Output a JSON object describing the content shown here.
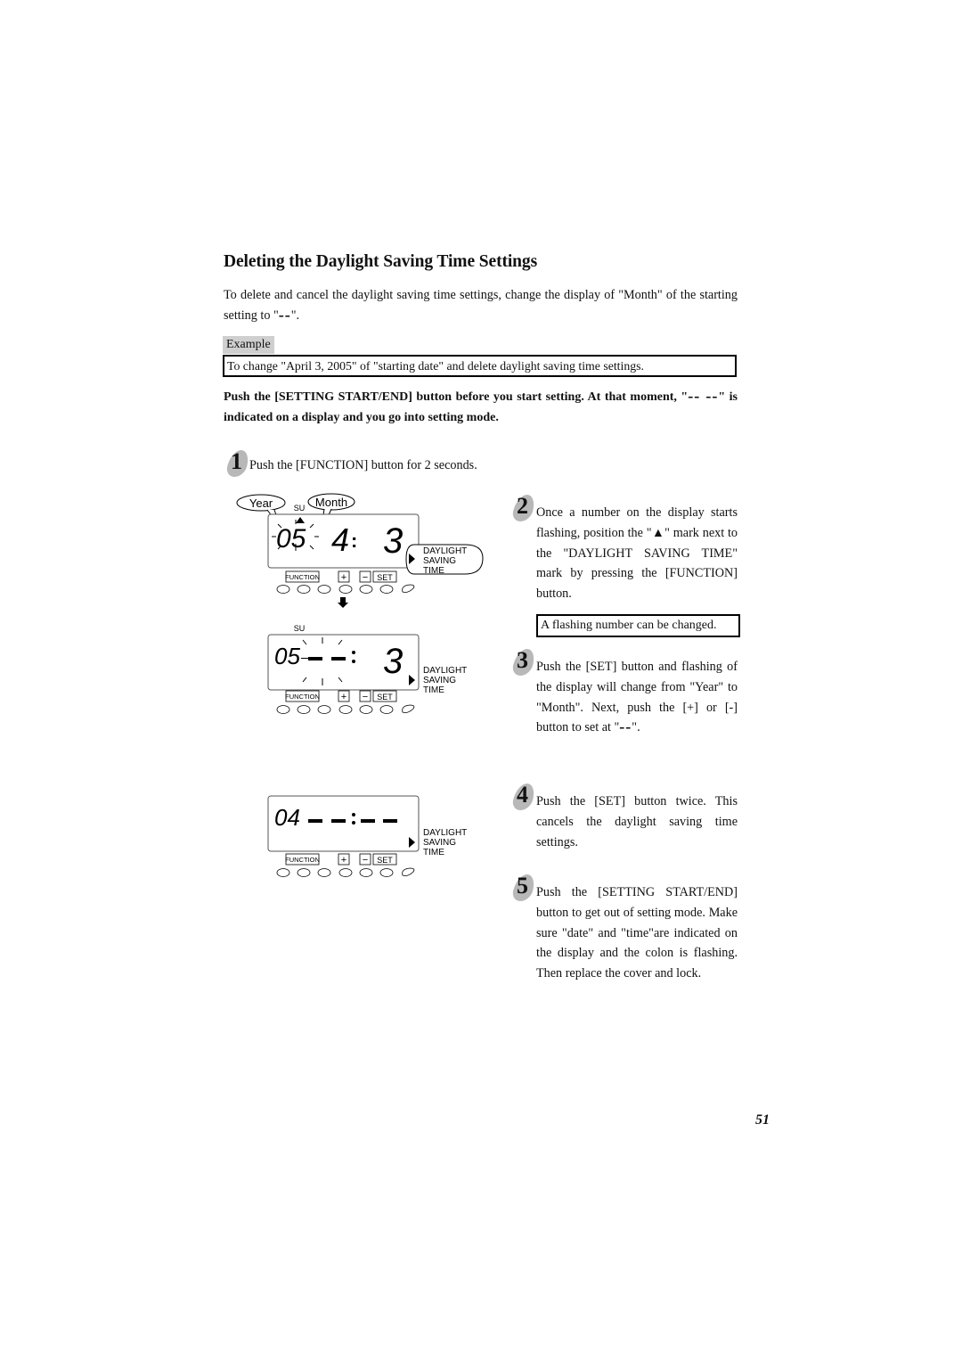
{
  "page": {
    "title": "Deleting the Daylight Saving Time Settings",
    "intro_before": "To delete and cancel the daylight saving time settings, change the display of \"Month\" of the starting setting to \"",
    "intro_dash": "––",
    "intro_after": "\".",
    "example_label": "Example",
    "example_text": "To change \"April 3, 2005\" of \"starting date\" and delete daylight saving time settings.",
    "bold_before": "Push the [SETTING START/END] button before you start setting. At that moment, \"",
    "bold_dash": "–– ––",
    "bold_after": "\" is indicated on a display and you go into setting mode.",
    "page_number": "51"
  },
  "steps": [
    {
      "number": "1",
      "text": "Push the [FUNCTION] button for 2 seconds."
    },
    {
      "number": "2",
      "text": "Once a number on the display starts flashing, position the \"▲\" mark next to the \"DAYLIGHT SAVING TIME\" mark by pressing the [FUNCTION] button."
    },
    {
      "number": "3",
      "text_before": "Push the [SET] button and flashing of the display will change from \"Year\" to \"Month\". Next, push the [+] or [-] button to set at \"",
      "dash": "––",
      "text_after": "\"."
    },
    {
      "number": "4",
      "text": "Push the [SET] button twice. This cancels the daylight saving time settings."
    },
    {
      "number": "5",
      "text": "Push the [SETTING START/END] button to get out of setting mode. Make sure \"date\" and \"time\"are indicated on the display and the colon is flashing.  Then replace the cover and lock."
    }
  ],
  "note": "A flashing number can be changed.",
  "displays": [
    {
      "callout_year": "Year",
      "callout_month": "Month",
      "su": "SU",
      "year": "05",
      "month": "4",
      "colon": ":",
      "day": "3",
      "dst": [
        "DAYLIGHT",
        "SAVING",
        "TIME"
      ],
      "buttons": [
        "FUNCTION",
        "+",
        "−",
        "SET"
      ]
    },
    {
      "su": "SU",
      "year": "05",
      "month": "--",
      "day": "3",
      "dst": [
        "DAYLIGHT",
        "SAVING",
        "TIME"
      ],
      "buttons": [
        "FUNCTION",
        "+",
        "−",
        "SET"
      ]
    },
    {
      "year": "04",
      "month": "--",
      "day": "--",
      "dst": [
        "DAYLIGHT",
        "SAVING",
        "TIME"
      ],
      "buttons": [
        "FUNCTION",
        "+",
        "−",
        "SET"
      ]
    }
  ]
}
